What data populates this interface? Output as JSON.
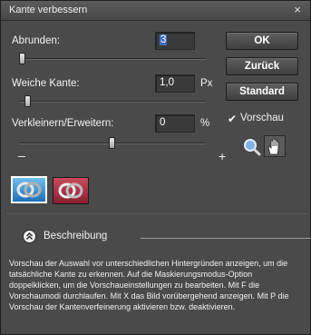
{
  "window": {
    "title": "Kante verbessern",
    "close_glyph": "×"
  },
  "fields": {
    "abrunden": {
      "label": "Abrunden:",
      "value": "3",
      "slider_fraction": 0.0
    },
    "weiche_kante": {
      "label": "Weiche Kante:",
      "value": "1,0",
      "unit": "Px",
      "slider_fraction": 0.05
    },
    "verkleinern": {
      "label": "Verkleinern/Erweitern:",
      "value": "0",
      "unit": "%",
      "slider_fraction": 0.5
    }
  },
  "slider_ends": {
    "minus": "–",
    "plus": "+"
  },
  "buttons": {
    "ok": "OK",
    "zurueck": "Zurück",
    "standard": "Standard"
  },
  "vorschau": {
    "label": "Vorschau",
    "checked": true
  },
  "tools": {
    "zoom": "zoom-icon",
    "hand": "hand-icon"
  },
  "preview_modes": [
    {
      "name": "blue-background",
      "selected": true
    },
    {
      "name": "red-overlay",
      "selected": false
    }
  ],
  "description": {
    "heading": "Beschreibung",
    "text": "Vorschau der Auswahl vor unterschiedlichen Hintergründen anzeigen, um die tatsächliche Kante zu erkennen. Auf die Maskierungsmodus-Option doppelklicken, um die Vorschaueinstellungen zu bearbeiten. Mit F die Vorschaumodi durchlaufen. Mit X das Bild vorübergehend anzeigen. Mit P die Vorschau der Kantenverfeinerung aktivieren bzw. deaktivieren."
  }
}
